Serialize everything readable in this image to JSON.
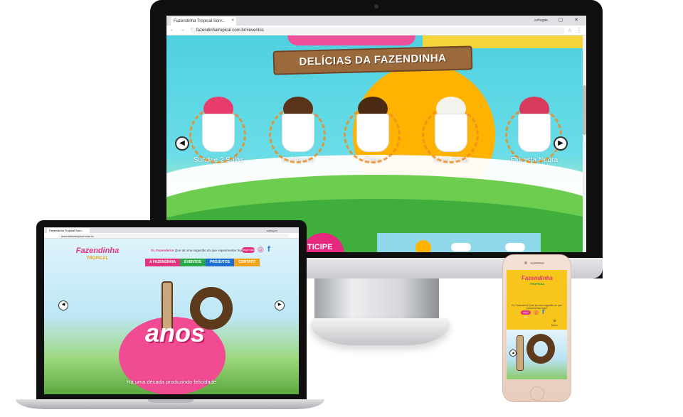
{
  "desktop": {
    "browser": {
      "tab_title": "Fazendinha Tropical Sorv...",
      "tab_close": "×",
      "profile": "saftagon",
      "window_controls": "–  ▢  ✕",
      "nav": "←  →  C",
      "url": "fazendinhatropical.com.br/#eventos",
      "star": "☆",
      "menu": "⋮"
    },
    "section_title": "DELÍCIAS DA FAZENDINHA",
    "products": [
      {
        "name": "Sundae 2 Bolas",
        "scoop_color": "#e83c6c"
      },
      {
        "name": "Recheado",
        "scoop_color": "#5b3318"
      },
      {
        "name": "Copo",
        "scoop_color": "#4a2a12"
      },
      {
        "name": "Vaca Preta",
        "scoop_color": "#f3f3ee"
      },
      {
        "name": "Floresta Negra",
        "scoop_color": "#d93a5c"
      }
    ],
    "prev_arrow": "◀",
    "next_arrow": "▶",
    "participe_label": "TICIPE"
  },
  "laptop": {
    "browser": {
      "tab_title": "Fazendinha Tropical Sorv...",
      "profile": "saftagon",
      "url": "fazendinhatropical.com.br"
    },
    "logo": {
      "main": "Fazendinha",
      "sub": "TROPICAL"
    },
    "topline": {
      "brand": "Oi, Fazendeiro!",
      "text": "Que tal uma sugestão do que experimentar hoje?"
    },
    "social": {
      "pill": "clique aqui",
      "instagram": "◎",
      "facebook": "f"
    },
    "nav": [
      {
        "label": "A FAZENDINHA",
        "color": "#e4337e"
      },
      {
        "label": "EVENTOS",
        "color": "#2aa84a"
      },
      {
        "label": "PRODUTOS",
        "color": "#1e6fd1"
      },
      {
        "label": "CONTATO",
        "color": "#f2a316"
      }
    ],
    "hero": {
      "word": "anos",
      "tagline": "Há uma década produzindo felicidade"
    },
    "prev_arrow": "◀",
    "next_arrow": "▶"
  },
  "phone": {
    "logo": {
      "main": "Fazendinha",
      "sub": "TROPICAL"
    },
    "text": "Oi, Fazendeiro! Que tal uma sugestão do que experimentar hoje?",
    "social": {
      "pill": "clique aqui",
      "instagram": "◎",
      "facebook": "f"
    },
    "menu": {
      "icon": "≡",
      "label": "Menu"
    },
    "prev_arrow": "◀"
  }
}
